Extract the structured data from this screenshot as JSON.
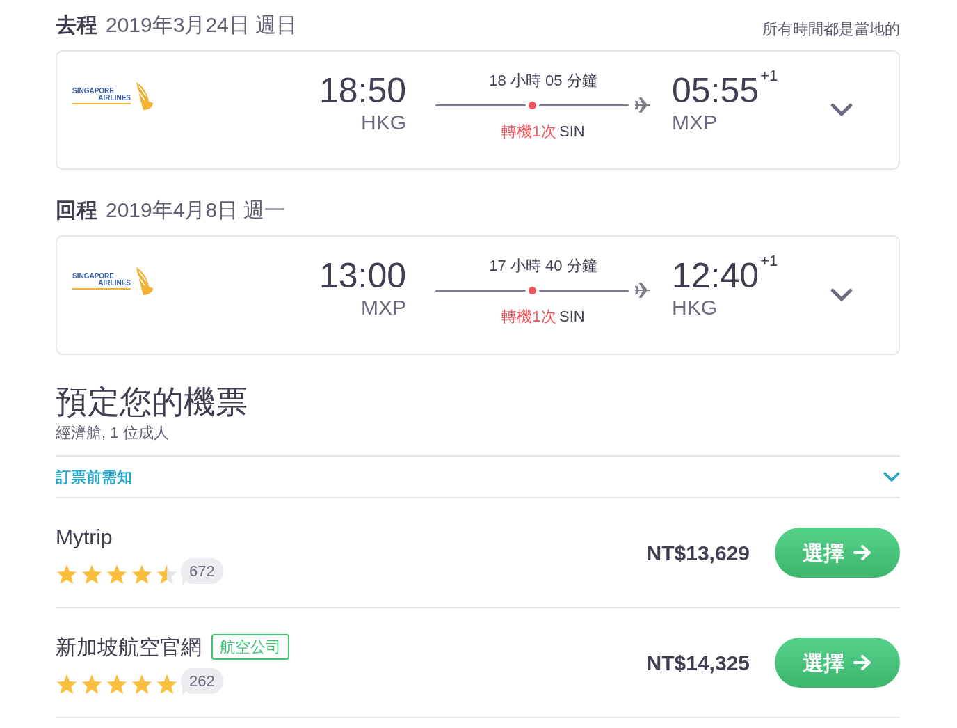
{
  "flights": [
    {
      "label": "去程",
      "date": "2019年3月24日 週日",
      "note": "所有時間都是當地的",
      "airline_logo": [
        "SINGAPORE",
        "AIRLINES"
      ],
      "depart_time": "18:50",
      "depart_airport": "HKG",
      "duration": "18 小時 05 分鐘",
      "stops": "轉機1次",
      "via": "SIN",
      "arrive_time": "05:55",
      "day_offset": "+1",
      "arrive_airport": "MXP",
      "expanded": false
    },
    {
      "label": "回程",
      "date": "2019年4月8日 週一",
      "airline_logo": [
        "SINGAPORE",
        "AIRLINES"
      ],
      "depart_time": "13:00",
      "depart_airport": "MXP",
      "duration": "17 小時 40 分鐘",
      "stops": "轉機1次",
      "via": "SIN",
      "arrive_time": "12:40",
      "day_offset": "+1",
      "arrive_airport": "HKG",
      "expanded": false
    }
  ],
  "booking": {
    "title": "預定您的機票",
    "subtitle": "經濟艙, 1 位成人",
    "notice": {
      "label": "訂票前需知",
      "expanded": false
    }
  },
  "offers": [
    {
      "name": "Mytrip",
      "stars": 4.5,
      "reviews": "672",
      "price": "NT$13,629",
      "button": "選擇"
    },
    {
      "name": "新加坡航空官網",
      "tag": "航空公司",
      "stars": 5,
      "reviews": "262",
      "price": "NT$14,325",
      "button": "選擇"
    }
  ]
}
